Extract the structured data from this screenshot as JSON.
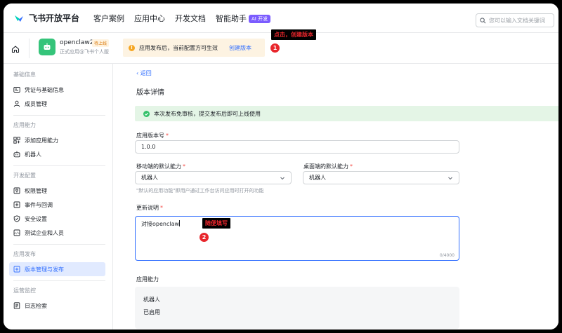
{
  "topnav": {
    "logo_text": "飞书开放平台",
    "links": [
      "客户案例",
      "应用中心",
      "开发文档",
      "智能助手"
    ],
    "ai_badge": "AI 开发",
    "search_placeholder": "您可以输入文档关键词"
  },
  "app": {
    "name": "openclaw2",
    "status": "待上线",
    "subtitle": "正式应用@飞书个人版",
    "notice_text": "应用发布后，当前配置方可生效",
    "notice_link": "创建版本"
  },
  "annotations": {
    "label1": "点击，创建版本",
    "num1": "1",
    "label2": "随便填写",
    "num2": "2"
  },
  "sidebar": {
    "sections": [
      {
        "title": "基础信息",
        "items": [
          "凭证与基础信息",
          "成员管理"
        ]
      },
      {
        "title": "应用能力",
        "items": [
          "添加应用能力",
          "机器人"
        ]
      },
      {
        "title": "开发配置",
        "items": [
          "权限管理",
          "事件与回调",
          "安全设置",
          "测试企业和人员"
        ]
      },
      {
        "title": "应用发布",
        "items": [
          "版本管理与发布"
        ]
      },
      {
        "title": "运营监控",
        "items": [
          "日志检索"
        ]
      }
    ]
  },
  "main": {
    "back": "返回",
    "title": "版本详情",
    "success": "本次发布免审核，提交发布后即可上线使用",
    "version_label": "应用版本号",
    "version_value": "1.0.0",
    "mobile_label": "移动端的默认能力",
    "mobile_value": "机器人",
    "desktop_label": "桌面端的默认能力",
    "desktop_value": "机器人",
    "default_hint": "\"默认的应用功能\"即用户通过工作台访问应用时打开的功能",
    "notes_label": "更新说明",
    "notes_value": "对接openclaw",
    "notes_counter": "0/4000",
    "capabilities_label": "应用能力",
    "capabilities": [
      "机器人",
      "已启用"
    ],
    "required_mark": "*"
  }
}
